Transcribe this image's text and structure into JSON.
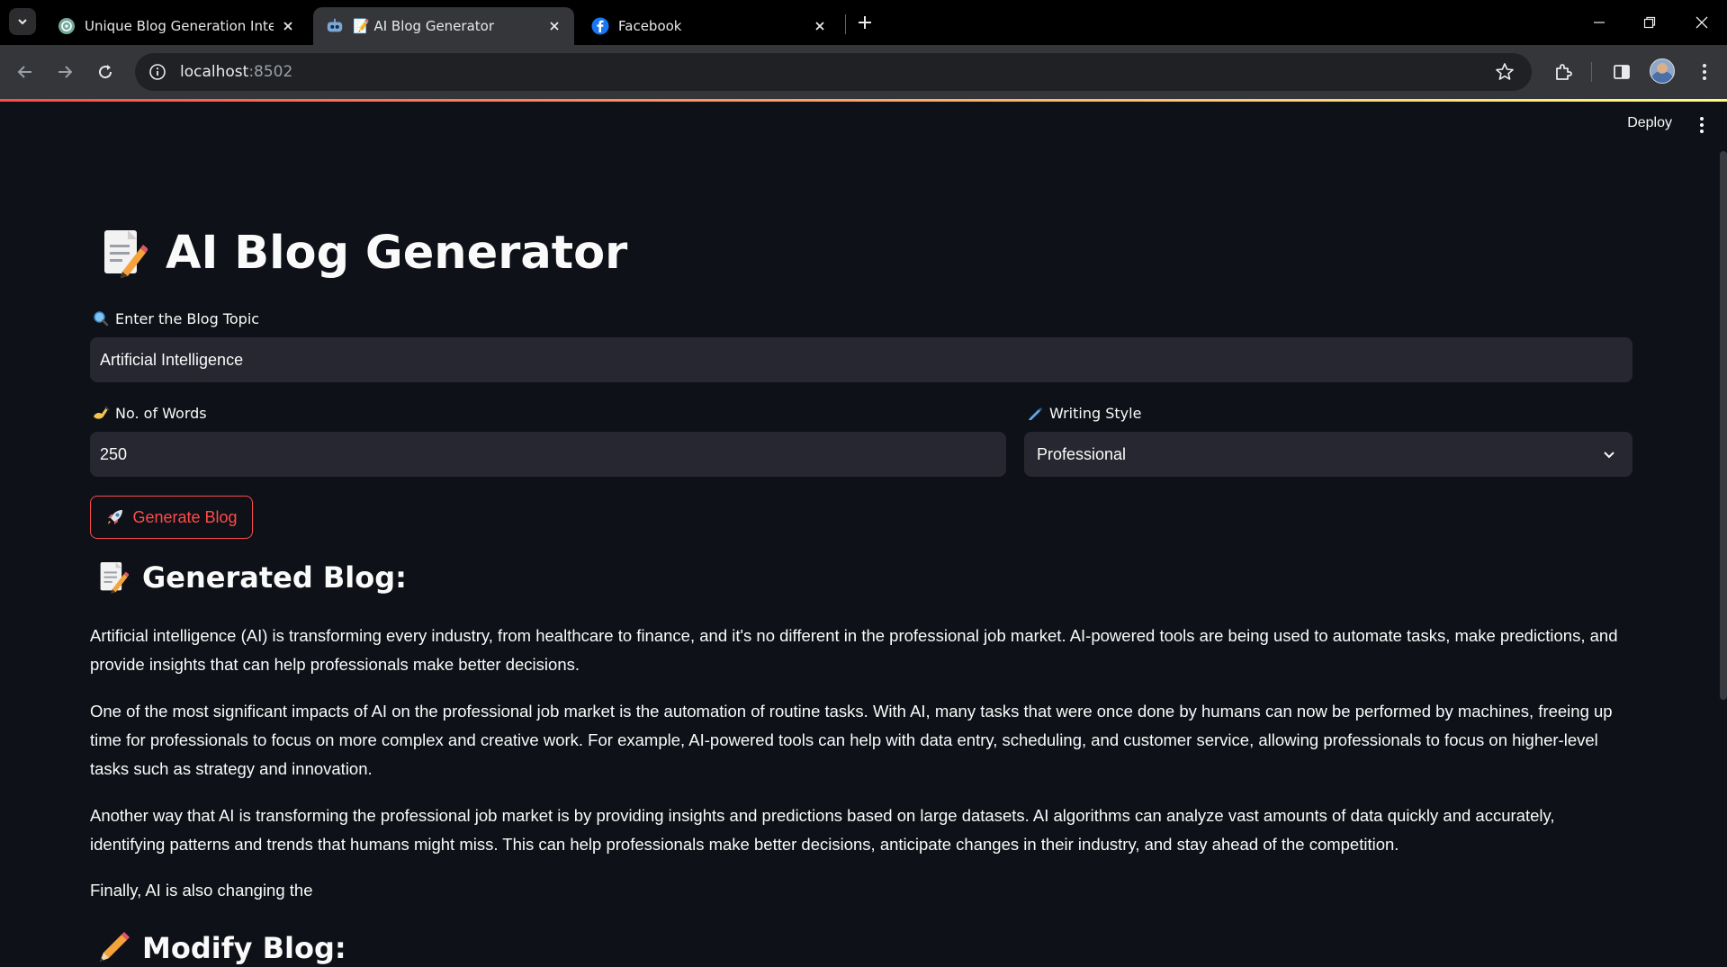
{
  "browser": {
    "tabs": [
      {
        "title": "Unique Blog Generation Interfa",
        "favicon": "openai-icon"
      },
      {
        "title": "📝 AI Blog Generator",
        "favicon": "robot-icon",
        "active": true
      },
      {
        "title": "Facebook",
        "favicon": "facebook-icon"
      }
    ],
    "url_host": "localhost",
    "url_port": ":8502"
  },
  "app": {
    "deploy_label": "Deploy",
    "title": "AI Blog Generator",
    "title_emoji": "📝",
    "topic": {
      "label": "Enter the Blog Topic",
      "icon": "🔍",
      "value": "Artificial Intelligence"
    },
    "words": {
      "label": "No. of Words",
      "icon": "✍️",
      "value": "250"
    },
    "style": {
      "label": "Writing Style",
      "icon": "🖊️",
      "value": "Professional"
    },
    "generate_button": {
      "label": "Generate Blog",
      "icon": "🚀"
    },
    "generated_title": "Generated Blog:",
    "generated_icon": "📝",
    "paragraphs": [
      "Artificial intelligence (AI) is transforming every industry, from healthcare to finance, and it's no different in the professional job market. AI-powered tools are being used to automate tasks, make predictions, and provide insights that can help professionals make better decisions.",
      "One of the most significant impacts of AI on the professional job market is the automation of routine tasks. With AI, many tasks that were once done by humans can now be performed by machines, freeing up time for professionals to focus on more complex and creative work. For example, AI-powered tools can help with data entry, scheduling, and customer service, allowing professionals to focus on higher-level tasks such as strategy and innovation.",
      "Another way that AI is transforming the professional job market is by providing insights and predictions based on large datasets. AI algorithms can analyze vast amounts of data quickly and accurately, identifying patterns and trends that humans might miss. This can help professionals make better decisions, anticipate changes in their industry, and stay ahead of the competition.",
      "Finally, AI is also changing the"
    ],
    "modify_title": "Modify Blog:",
    "modify_icon": "✏️"
  },
  "colors": {
    "accent": "#ff4b4b",
    "background": "#0e1117",
    "input_bg": "#262730"
  }
}
